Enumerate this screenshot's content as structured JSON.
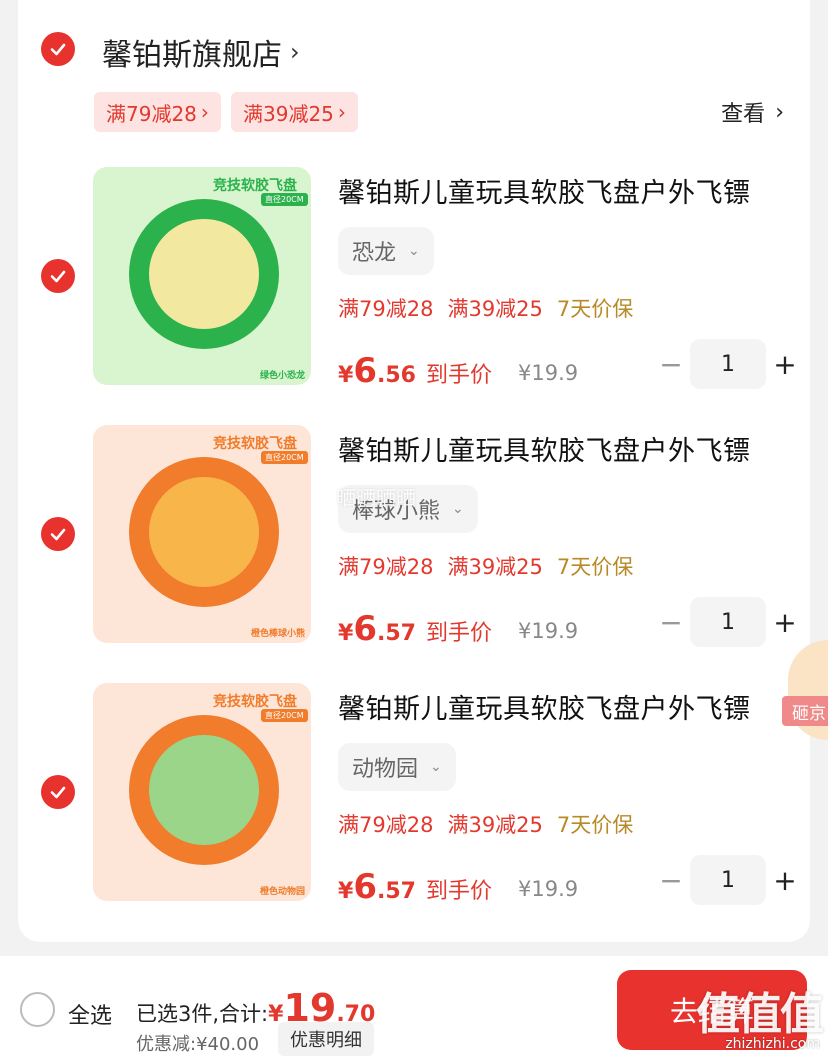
{
  "store": {
    "name": "馨铂斯旗舰店",
    "chevron": "›",
    "view_more": "查看",
    "view_more_chevron": "›"
  },
  "store_promos": [
    {
      "label": "满79减28",
      "chevron": "›"
    },
    {
      "label": "满39减25",
      "chevron": "›"
    }
  ],
  "items": [
    {
      "title": "馨铂斯儿童玩具软胶飞盘户外飞镖",
      "variant": "恐龙",
      "promos": [
        "满79减28",
        "满39减25",
        "7天价保"
      ],
      "price_symbol": "¥",
      "price_int": "6",
      "price_dec": ".56",
      "price_label": "到手价",
      "original_price": "¥19.9",
      "quantity": "1",
      "thumb_banner": "竞技软胶飞盘",
      "thumb_sub": "直径20CM",
      "thumb_corner": "绿色小恐龙",
      "colors": {
        "bg": "#d9f5d0",
        "disc": "#2bb24c",
        "inner": "#f3e8a0",
        "banner": "#2bb24c"
      }
    },
    {
      "title": "馨铂斯儿童玩具软胶飞盘户外飞镖",
      "variant": "棒球小熊",
      "promos": [
        "满79减28",
        "满39减25",
        "7天价保"
      ],
      "price_symbol": "¥",
      "price_int": "6",
      "price_dec": ".57",
      "price_label": "到手价",
      "original_price": "¥19.9",
      "quantity": "1",
      "thumb_banner": "竞技软胶飞盘",
      "thumb_sub": "直径20CM",
      "thumb_corner": "橙色棒球小熊",
      "colors": {
        "bg": "#fde6d8",
        "disc": "#f07c2c",
        "inner": "#f8b64a",
        "banner": "#f07c2c"
      }
    },
    {
      "title": "馨铂斯儿童玩具软胶飞盘户外飞镖",
      "variant": "动物园",
      "promos": [
        "满79减28",
        "满39减25",
        "7天价保"
      ],
      "price_symbol": "¥",
      "price_int": "6",
      "price_dec": ".57",
      "price_label": "到手价",
      "original_price": "¥19.9",
      "quantity": "1",
      "thumb_banner": "竞技软胶飞盘",
      "thumb_sub": "直径20CM",
      "thumb_corner": "橙色动物园",
      "colors": {
        "bg": "#fde6d8",
        "disc": "#f07c2c",
        "inner": "#9bd58a",
        "banner": "#f07c2c"
      }
    }
  ],
  "stepper": {
    "minus": "−",
    "plus": "+"
  },
  "watermark": "晒晒晒晒",
  "float_badge": "砸京",
  "footer": {
    "select_all": "全选",
    "selected_label": "已选3件,合计:",
    "total_symbol": "¥",
    "total_int": "19",
    "total_dec": ".70",
    "discount": "优惠减:¥40.00",
    "detail_button": "优惠明细",
    "checkout": "去结算",
    "site_mark": "值值值",
    "site_url": "zhizhizhi.com"
  },
  "accent_color": "#e8322e"
}
